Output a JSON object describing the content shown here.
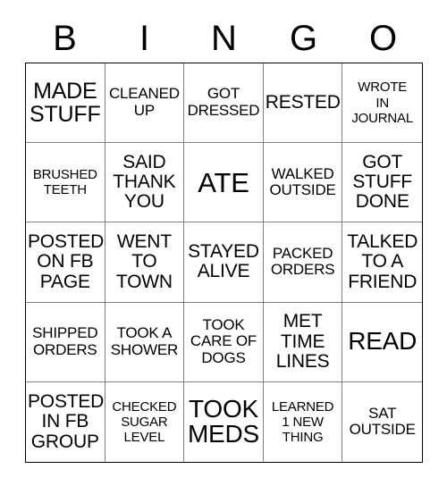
{
  "card": {
    "type": "bingo-card",
    "header_letters": [
      "B",
      "I",
      "N",
      "G",
      "O"
    ],
    "columns": 5,
    "rows": 5,
    "colors": {
      "text": "#000000",
      "background": "#ffffff",
      "outer_border": "#000000",
      "inner_border": "#808080"
    },
    "cells": [
      {
        "text": "MADE\nSTUFF",
        "size": "lg"
      },
      {
        "text": "CLEANED\nUP",
        "size": "sm"
      },
      {
        "text": "GOT\nDRESSED",
        "size": "sm"
      },
      {
        "text": "RESTED",
        "size": "md"
      },
      {
        "text": "WROTE\nIN\nJOURNAL",
        "size": "xs"
      },
      {
        "text": "BRUSHED\nTEETH",
        "size": "xs"
      },
      {
        "text": "SAID\nTHANK\nYOU",
        "size": "md"
      },
      {
        "text": "ATE",
        "size": "xxl"
      },
      {
        "text": "WALKED\nOUTSIDE",
        "size": "sm"
      },
      {
        "text": "GOT\nSTUFF\nDONE",
        "size": "md"
      },
      {
        "text": "POSTED\nON FB\nPAGE",
        "size": "md"
      },
      {
        "text": "WENT\nTO\nTOWN",
        "size": "md"
      },
      {
        "text": "STAYED\nALIVE",
        "size": "md"
      },
      {
        "text": "PACKED\nORDERS",
        "size": "sm"
      },
      {
        "text": "TALKED\nTO A\nFRIEND",
        "size": "md"
      },
      {
        "text": "SHIPPED\nORDERS",
        "size": "sm"
      },
      {
        "text": "TOOK A\nSHOWER",
        "size": "sm"
      },
      {
        "text": "TOOK\nCARE OF\nDOGS",
        "size": "sm"
      },
      {
        "text": "MET\nTIME\nLINES",
        "size": "md"
      },
      {
        "text": "READ",
        "size": "xl"
      },
      {
        "text": "POSTED\nIN FB\nGROUP",
        "size": "md"
      },
      {
        "text": "CHECKED\nSUGAR\nLEVEL",
        "size": "xs"
      },
      {
        "text": "TOOK\nMEDS",
        "size": "xl"
      },
      {
        "text": "LEARNED\n1 NEW\nTHING",
        "size": "xs"
      },
      {
        "text": "SAT\nOUTSIDE",
        "size": "sm"
      }
    ]
  }
}
